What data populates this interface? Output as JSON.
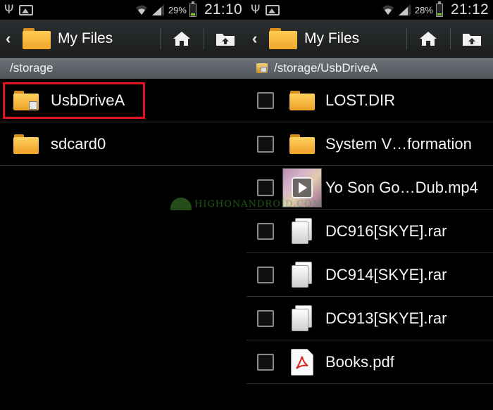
{
  "left": {
    "status": {
      "battery_pct": "29%",
      "time": "21:10",
      "battery_level": 0.29
    },
    "action_bar": {
      "title": "My Files"
    },
    "path": "/storage",
    "items": [
      {
        "label": "UsbDriveA",
        "icon": "usb-folder-icon"
      },
      {
        "label": "sdcard0",
        "icon": "folder-icon"
      }
    ]
  },
  "right": {
    "status": {
      "battery_pct": "28%",
      "time": "21:12",
      "battery_level": 0.28
    },
    "action_bar": {
      "title": "My Files"
    },
    "path": "/storage/UsbDriveA",
    "items": [
      {
        "label": "LOST.DIR",
        "icon": "folder-icon",
        "checked": false
      },
      {
        "label": "System V…formation",
        "icon": "folder-icon",
        "checked": false
      },
      {
        "label": "Yo Son Go…Dub.mp4",
        "icon": "video-thumbnail",
        "checked": false
      },
      {
        "label": "DC916[SKYE].rar",
        "icon": "file-icon",
        "checked": false
      },
      {
        "label": "DC914[SKYE].rar",
        "icon": "file-icon",
        "checked": false
      },
      {
        "label": "DC913[SKYE].rar",
        "icon": "file-icon",
        "checked": false
      },
      {
        "label": "Books.pdf",
        "icon": "pdf-icon",
        "checked": false
      }
    ]
  },
  "watermark": "HIGHONANDROID.COM",
  "colors": {
    "highlight": "#e1151d",
    "folder": "#f0a62a",
    "action_bar": "#2c2f31",
    "path_bar": "#5f6469",
    "battery_fill": "#7ec820"
  }
}
